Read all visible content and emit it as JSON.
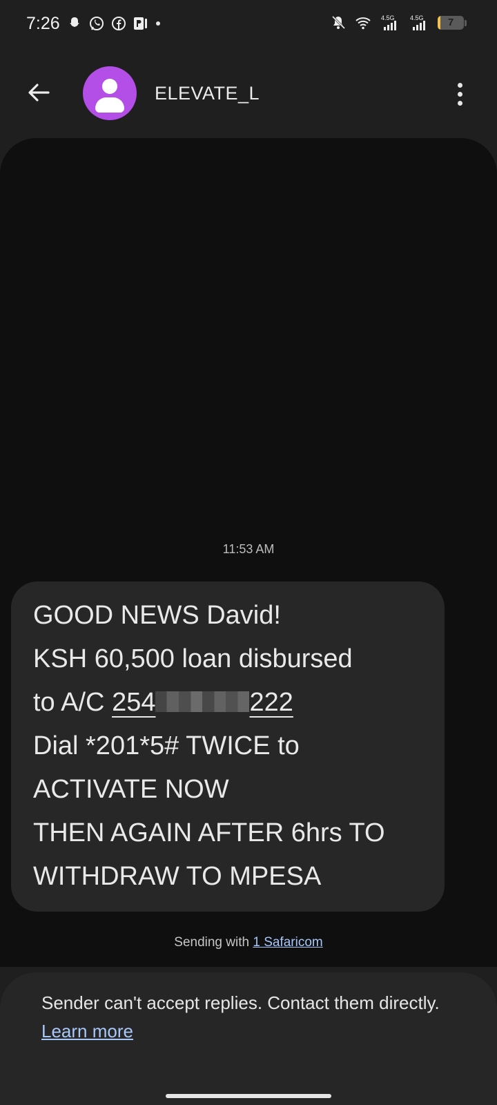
{
  "status_bar": {
    "time": "7:26",
    "left_icons": [
      "snapchat-icon",
      "whatsapp-icon",
      "facebook-icon",
      "parking-app-icon"
    ],
    "right_icons": [
      "muted-bell-icon",
      "wifi-icon",
      "signal-4.5g-icon",
      "signal-4.5g-icon"
    ],
    "network_label_1": "4.5G",
    "network_label_2": "4.5G",
    "battery_level": "7",
    "battery_color": "#f2c14e"
  },
  "header": {
    "contact_name": "ELEVATE_L",
    "avatar_color": "#b34ee6"
  },
  "conversation": {
    "timestamp": "11:53 AM",
    "message": {
      "line1": "GOOD NEWS David!",
      "line2": "KSH 60,500 loan disbursed",
      "line3_prefix": "to A/C ",
      "account_start": "254",
      "account_end": "222",
      "line4": "Dial *201*5# TWICE to",
      "line5": "ACTIVATE NOW",
      "line6": "THEN AGAIN AFTER 6hrs TO",
      "line7": "WITHDRAW TO MPESA"
    },
    "sending_prefix": "Sending with ",
    "sim_link": "1 Safaricom"
  },
  "notice": {
    "text": "Sender can't accept replies. Contact them directly. ",
    "link": "Learn more"
  },
  "colors": {
    "background": "#1f1f1f",
    "conversation_bg": "#0f0f0f",
    "bubble": "#272727",
    "link": "#a8c7fa"
  }
}
